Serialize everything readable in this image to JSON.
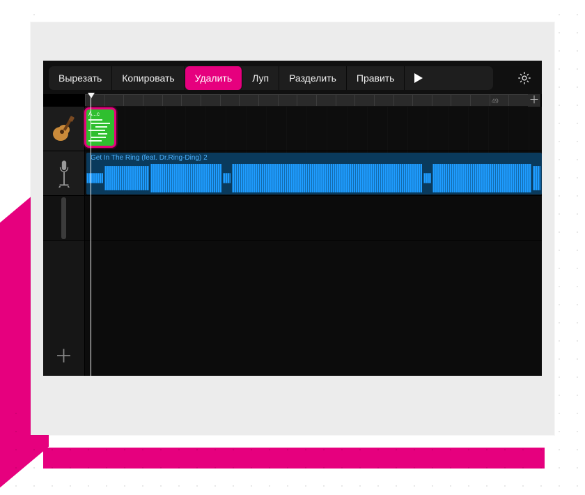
{
  "contextMenu": {
    "items": [
      {
        "label": "Вырезать",
        "highlight": false,
        "name": "cut-menu-item"
      },
      {
        "label": "Копировать",
        "highlight": false,
        "name": "copy-menu-item"
      },
      {
        "label": "Удалить",
        "highlight": true,
        "name": "delete-menu-item"
      },
      {
        "label": "Луп",
        "highlight": false,
        "name": "loop-menu-item"
      },
      {
        "label": "Разделить",
        "highlight": false,
        "name": "split-menu-item"
      },
      {
        "label": "Править",
        "highlight": false,
        "name": "edit-menu-item"
      }
    ],
    "more": "▶"
  },
  "ruler": {
    "ticks": [
      "",
      "",
      "",
      "",
      "",
      "",
      "",
      "",
      "",
      "",
      "",
      "",
      "",
      "",
      "",
      "",
      "",
      "",
      "",
      "",
      "",
      "49",
      ""
    ]
  },
  "tracks": {
    "midi": {
      "clipTitle": "A...c"
    },
    "audio": {
      "clipTitle": "Get In The Ring (feat. Dr.Ring-Ding) 2"
    }
  },
  "colors": {
    "accentPink": "#e6007e",
    "clipGreen": "#2fbf2f",
    "waveBlue": "#1e9cff"
  }
}
